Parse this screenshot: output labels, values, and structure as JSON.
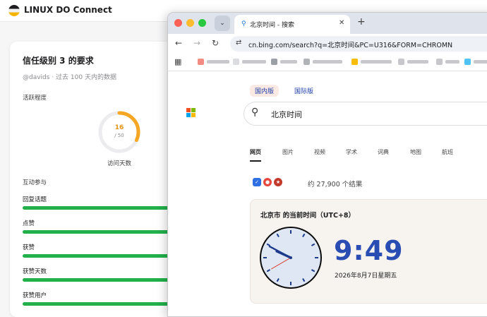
{
  "background_app": {
    "title": "LINUX DO Connect",
    "card": {
      "title": "信任级别 3 的要求",
      "subtitle": "@davids · 过去 100 天内的数据",
      "section_activity": "活跃程度",
      "visit_days": {
        "value": "16",
        "max": "/ 50",
        "label": "访问天数",
        "fraction": 0.32
      },
      "section_interaction": "互动参与",
      "metrics": [
        {
          "label": "回复话题"
        },
        {
          "label": "点赞"
        },
        {
          "label": "获赞"
        },
        {
          "label": "获赞天数"
        },
        {
          "label": "获赞用户"
        }
      ]
    }
  },
  "browser": {
    "tab": {
      "title": "北京时间 - 搜索",
      "favicon": "bing-search-icon"
    },
    "url": "cn.bing.com/search?q=北京时间&PC=U316&FORM=CHROMN",
    "colors": {
      "tabstrip": "#dfe3eb",
      "accent": "#2a4db3",
      "green_bar": "#22b04b",
      "ring": "#f5a623"
    }
  },
  "bing": {
    "scopes": [
      "国内版",
      "国际版"
    ],
    "query": "北京时间",
    "tabs": [
      "网页",
      "图片",
      "视频",
      "学术",
      "词典",
      "地图",
      "航班"
    ],
    "result_count": "约 27,900 个结果",
    "answer": {
      "title": "北京市 的当前时间（UTC+8）",
      "time": "9:49",
      "date": "2026年8月7日星期五",
      "clock": {
        "hour": 9,
        "minute": 49,
        "second": 40
      }
    }
  }
}
